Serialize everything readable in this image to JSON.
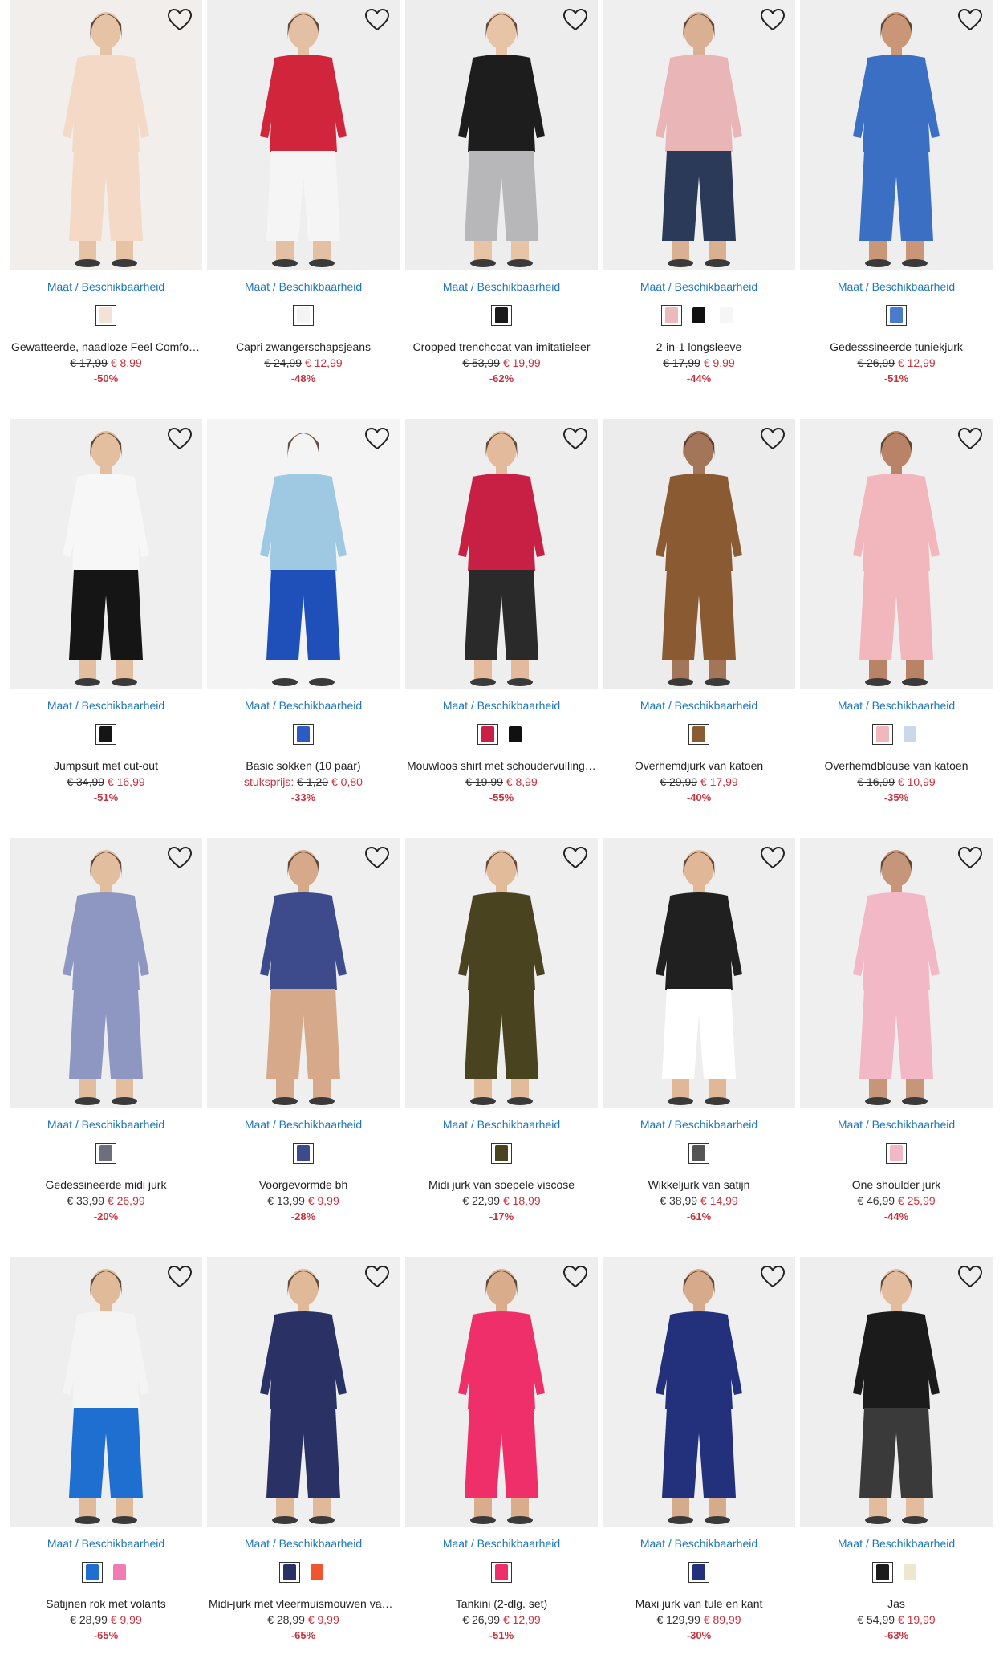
{
  "common": {
    "size_link": "Maat / Beschikbaarheid"
  },
  "colors": {
    "price_red": "#c8323e",
    "link_blue": "#1e77b8"
  },
  "products": [
    {
      "name": "Gewatteerde, naadloze Feel Comfort slip",
      "old_price": "€ 17,99",
      "new_price": "€ 8,99",
      "unit_label": "",
      "discount": "-50%",
      "bg": "#f1eeec",
      "skin": "#e6c3a5",
      "top": "#f3d9c6",
      "bottom": "#f3d9c6",
      "swatches": [
        "#f3e2d6"
      ]
    },
    {
      "name": "Capri zwangerschapsjeans",
      "old_price": "€ 24,99",
      "new_price": "€ 12,99",
      "unit_label": "",
      "discount": "-48%",
      "bg": "#eeeeee",
      "skin": "#e3bfa3",
      "top": "#d0253b",
      "bottom": "#f5f5f5",
      "swatches": [
        "#f4f4f4"
      ]
    },
    {
      "name": "Cropped trenchcoat van imitatieleer",
      "old_price": "€ 53,99",
      "new_price": "€ 19,99",
      "unit_label": "",
      "discount": "-62%",
      "bg": "#ededed",
      "skin": "#e7c4a6",
      "top": "#1d1d1d",
      "bottom": "#b7b7b9",
      "swatches": [
        "#1a1a1a"
      ]
    },
    {
      "name": "2-in-1 longsleeve",
      "old_price": "€ 17,99",
      "new_price": "€ 9,99",
      "unit_label": "",
      "discount": "-44%",
      "bg": "#efefef",
      "skin": "#d9b192",
      "top": "#e9b5b7",
      "bottom": "#2b3a59",
      "swatches": [
        "#ecb9bd",
        "#111111",
        "#f6f6f6"
      ]
    },
    {
      "name": "Gedesssineerde tuniekjurk",
      "old_price": "€ 26,99",
      "new_price": "€ 12,99",
      "unit_label": "",
      "discount": "-51%",
      "bg": "#eeeeee",
      "skin": "#c99777",
      "top": "#3a6fc4",
      "bottom": "#3a6fc4",
      "swatches": [
        "#4a7ccb"
      ]
    },
    {
      "name": "Jumpsuit met cut-out",
      "old_price": "€ 34,99",
      "new_price": "€ 16,99",
      "unit_label": "",
      "discount": "-51%",
      "bg": "#efefef",
      "skin": "#e4bf9f",
      "top": "#f7f7f7",
      "bottom": "#151515",
      "swatches": [
        "#151515"
      ]
    },
    {
      "name": "Basic sokken (10 paar)",
      "old_price": "€ 1,20",
      "new_price": "€ 0,80",
      "unit_label": "stuksprijs:",
      "discount": "-33%",
      "bg": "#f4f4f4",
      "skin": "#f4f4f4",
      "top": "#9fc8e2",
      "bottom": "#1f4fb8",
      "swatches": [
        "#2d5cc0"
      ]
    },
    {
      "name": "Mouwloos shirt met schoudervullingen",
      "old_price": "€ 19,99",
      "new_price": "€ 8,99",
      "unit_label": "",
      "discount": "-55%",
      "bg": "#eeeeee",
      "skin": "#e3bb9c",
      "top": "#c81f44",
      "bottom": "#2a2a2a",
      "swatches": [
        "#c81f44",
        "#111111"
      ]
    },
    {
      "name": "Overhemdjurk van katoen",
      "old_price": "€ 29,99",
      "new_price": "€ 17,99",
      "unit_label": "",
      "discount": "-40%",
      "bg": "#ececec",
      "skin": "#a37559",
      "top": "#8a5a33",
      "bottom": "#8a5a33",
      "swatches": [
        "#8a5a33"
      ]
    },
    {
      "name": "Overhemdblouse van katoen",
      "old_price": "€ 16,99",
      "new_price": "€ 10,99",
      "unit_label": "",
      "discount": "-35%",
      "bg": "#efefef",
      "skin": "#b98367",
      "top": "#f2b6bd",
      "bottom": "#f2b6bd",
      "swatches": [
        "#f2b6bd",
        "#c9d9ea"
      ]
    },
    {
      "name": "Gedessineerde midi jurk",
      "old_price": "€ 33,99",
      "new_price": "€ 26,99",
      "unit_label": "",
      "discount": "-20%",
      "bg": "#eeeeee",
      "skin": "#e2bd9e",
      "top": "#8d97c2",
      "bottom": "#8d97c2",
      "swatches": [
        "#6f6f7b"
      ]
    },
    {
      "name": "Voorgevormde bh",
      "old_price": "€ 13,99",
      "new_price": "€ 9,99",
      "unit_label": "",
      "discount": "-28%",
      "bg": "#efefef",
      "skin": "#d6a98a",
      "top": "#3d4a8c",
      "bottom": "#d6a98a",
      "swatches": [
        "#3d4a8c"
      ]
    },
    {
      "name": "Midi jurk van soepele viscose",
      "old_price": "€ 22,99",
      "new_price": "€ 18,99",
      "unit_label": "",
      "discount": "-17%",
      "bg": "#efefef",
      "skin": "#e2bb9b",
      "top": "#4a4320",
      "bottom": "#4a4320",
      "swatches": [
        "#4a4320"
      ]
    },
    {
      "name": "Wikkeljurk van satijn",
      "old_price": "€ 38,99",
      "new_price": "€ 14,99",
      "unit_label": "",
      "discount": "-61%",
      "bg": "#eeeeee",
      "skin": "#e0b897",
      "top": "#202020",
      "bottom": "#ffffff",
      "swatches": [
        "#555555"
      ]
    },
    {
      "name": "One shoulder jurk",
      "old_price": "€ 46,99",
      "new_price": "€ 25,99",
      "unit_label": "",
      "discount": "-44%",
      "bg": "#efefef",
      "skin": "#c5967a",
      "top": "#f3b8c6",
      "bottom": "#f3b8c6",
      "swatches": [
        "#f3b8c6"
      ]
    },
    {
      "name": "Satijnen rok met volants",
      "old_price": "€ 28,99",
      "new_price": "€ 9,99",
      "unit_label": "",
      "discount": "-65%",
      "bg": "#eeeeee",
      "skin": "#e1ba9a",
      "top": "#f4f4f4",
      "bottom": "#1f6fd1",
      "swatches": [
        "#1f6fd1",
        "#f07cb3"
      ]
    },
    {
      "name": "Midi-jurk met vleermuismouwen van satijn",
      "old_price": "€ 28,99",
      "new_price": "€ 9,99",
      "unit_label": "",
      "discount": "-65%",
      "bg": "#efefef",
      "skin": "#e0b999",
      "top": "#2a3164",
      "bottom": "#2a3164",
      "swatches": [
        "#2a3164",
        "#f0562e"
      ]
    },
    {
      "name": "Tankini (2-dlg. set)",
      "old_price": "€ 26,99",
      "new_price": "€ 12,99",
      "unit_label": "",
      "discount": "-51%",
      "bg": "#eeeeee",
      "skin": "#d9ac8b",
      "top": "#ef2f6a",
      "bottom": "#ef2f6a",
      "swatches": [
        "#ef2f6a"
      ]
    },
    {
      "name": "Maxi jurk van tule en kant",
      "old_price": "€ 129,99",
      "new_price": "€ 89,99",
      "unit_label": "",
      "discount": "-30%",
      "bg": "#efefef",
      "skin": "#d6ab8c",
      "top": "#23317c",
      "bottom": "#23317c",
      "swatches": [
        "#23317c"
      ]
    },
    {
      "name": "Jas",
      "old_price": "€ 54,99",
      "new_price": "€ 19,99",
      "unit_label": "",
      "discount": "-63%",
      "bg": "#eeeeee",
      "skin": "#e3bc9d",
      "top": "#1b1b1b",
      "bottom": "#3a3a3a",
      "swatches": [
        "#1b1b1b",
        "#eee7d0"
      ]
    }
  ]
}
